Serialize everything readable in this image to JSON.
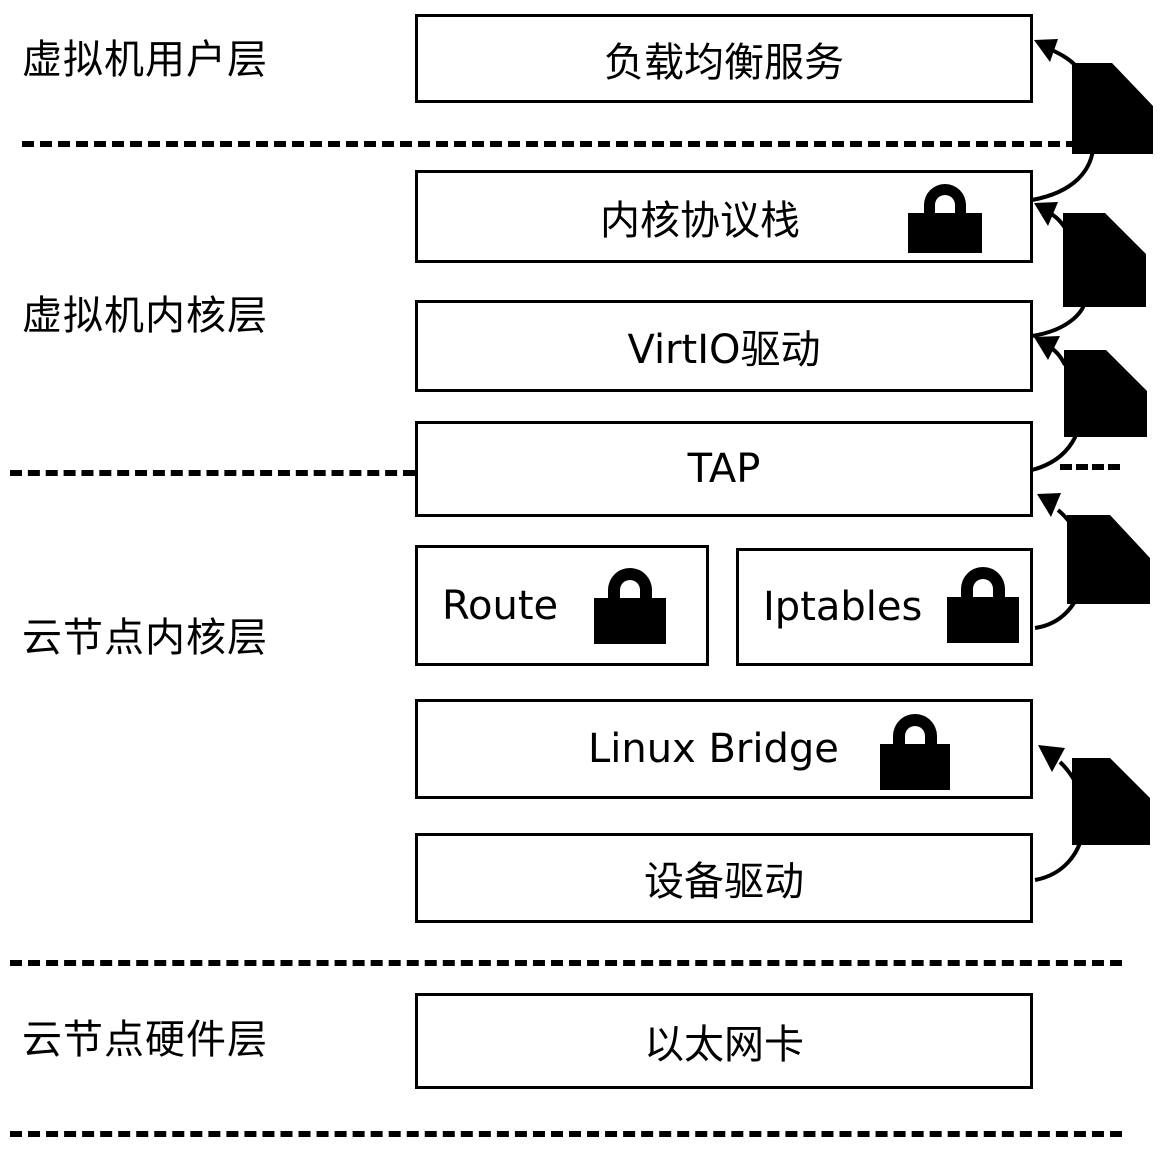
{
  "layers": [
    {
      "label": "虚拟机用户层"
    },
    {
      "label": "虚拟机内核层"
    },
    {
      "label": "云节点内核层"
    },
    {
      "label": "云节点硬件层"
    }
  ],
  "components": {
    "load_balancer": "负载均衡服务",
    "kernel_stack": "内核协议栈",
    "virtio": "VirtIO驱动",
    "tap": "TAP",
    "route": "Route",
    "iptables": "Iptables",
    "linux_bridge": "Linux Bridge",
    "device_driver": "设备驱动",
    "nic": "以太网卡"
  },
  "locked_components": [
    "内核协议栈",
    "Route",
    "Iptables",
    "Linux Bridge"
  ],
  "packet_flow": [
    "设备驱动",
    "Linux Bridge",
    "Iptables",
    "TAP",
    "VirtIO驱动",
    "内核协议栈",
    "负载均衡服务"
  ],
  "icons": {
    "lock": "lock-icon",
    "packet": "packet-document-icon",
    "arrow": "curved-arrow-icon"
  },
  "colors": {
    "stroke": "#000000",
    "background": "#ffffff"
  }
}
